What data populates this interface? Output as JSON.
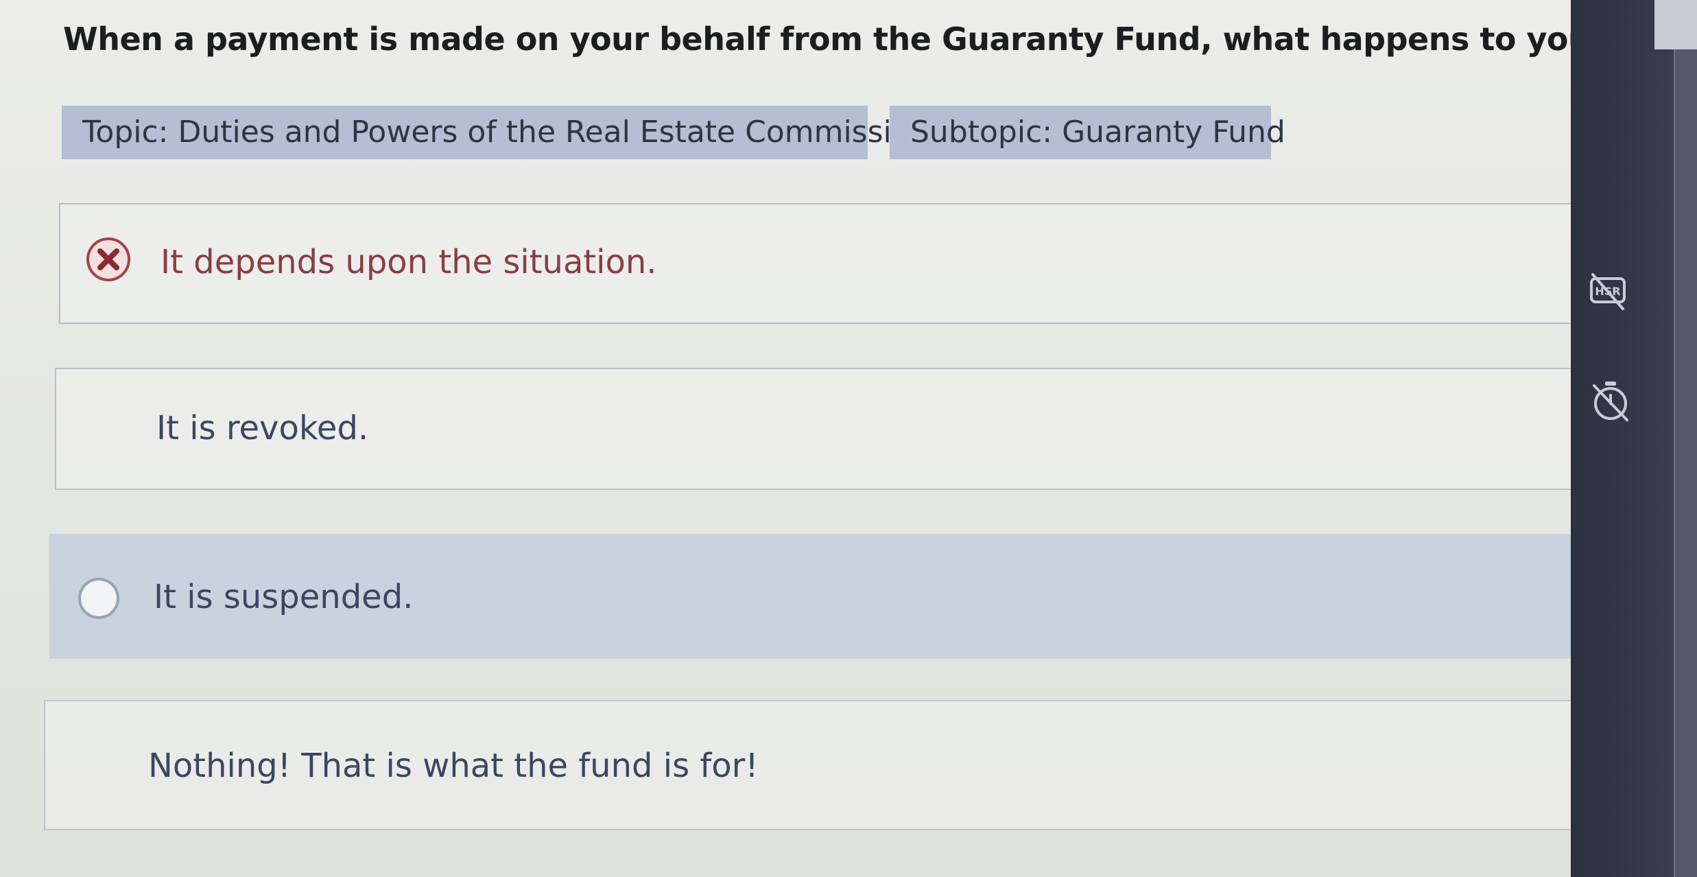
{
  "question": "When a payment is made on your behalf from the Guaranty Fund, what happens to your real estate license?",
  "tags": {
    "topic": "Topic: Duties and Powers of the Real Estate Commission",
    "subtopic": "Subtopic: Guaranty Fund"
  },
  "options": [
    {
      "text": "It depends upon the situation.",
      "state": "incorrect"
    },
    {
      "text": "It is revoked.",
      "state": "unselected"
    },
    {
      "text": "It is suspended.",
      "state": "highlighted"
    },
    {
      "text": "Nothing! That is what the fund is for!",
      "state": "unselected"
    }
  ],
  "sidebar": {
    "icons": [
      "hsr-hidden-icon",
      "timer-off-icon"
    ]
  },
  "colors": {
    "incorrect": "#a0444c",
    "tag_bg": "#b4bfd4",
    "highlight_bg": "#c9d3df",
    "sidebar_bg": "#2c3140"
  }
}
